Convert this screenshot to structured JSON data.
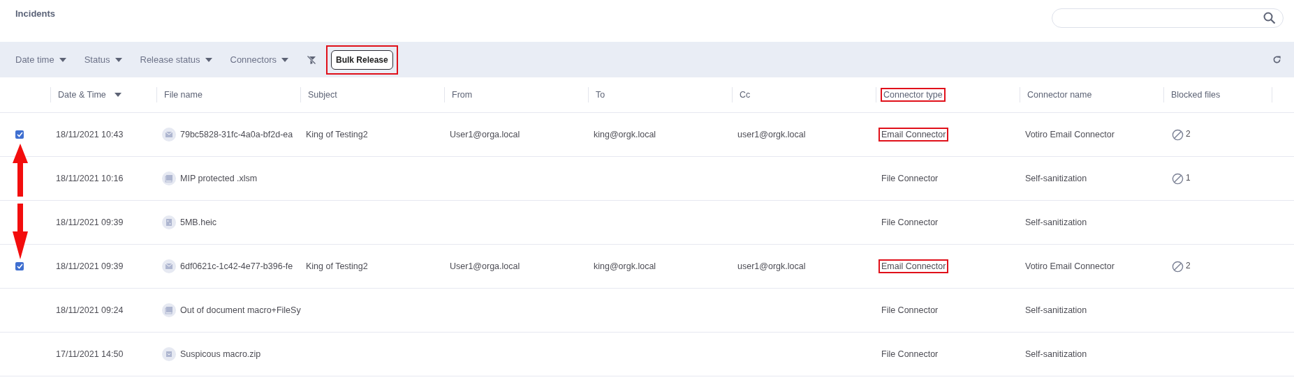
{
  "page": {
    "title": "Incidents"
  },
  "toolbar": {
    "filters": [
      {
        "label": "Date time"
      },
      {
        "label": "Status"
      },
      {
        "label": "Release status"
      },
      {
        "label": "Connectors"
      }
    ],
    "bulk_release": {
      "label": "Bulk Release",
      "highlighted": true
    }
  },
  "table": {
    "columns": [
      {
        "label": "Date & Time",
        "sorted": true,
        "highlighted": false
      },
      {
        "label": "File name",
        "sorted": false,
        "highlighted": false
      },
      {
        "label": "Subject",
        "sorted": false,
        "highlighted": false
      },
      {
        "label": "From",
        "sorted": false,
        "highlighted": false
      },
      {
        "label": "To",
        "sorted": false,
        "highlighted": false
      },
      {
        "label": "Cc",
        "sorted": false,
        "highlighted": false
      },
      {
        "label": "Connector type",
        "sorted": false,
        "highlighted": true
      },
      {
        "label": "Connector name",
        "sorted": false,
        "highlighted": false
      },
      {
        "label": "Blocked files",
        "sorted": false,
        "highlighted": false
      }
    ],
    "rows": [
      {
        "checked": true,
        "date": "18/11/2021 10:43",
        "file": {
          "name": "79bc5828-31fc-4a0a-bf2d-ea",
          "kind": "email"
        },
        "subject": "King of Testing2",
        "from": "User1@orga.local",
        "to": "king@orgk.local",
        "cc": "user1@orgk.local",
        "connector_type": {
          "text": "Email Connector",
          "highlighted": true
        },
        "connector_name": "Votiro Email Connector",
        "blocked_files": "2"
      },
      {
        "checked": false,
        "date": "18/11/2021 10:16",
        "file": {
          "name": "MIP protected .xlsm",
          "kind": "spreadsheet"
        },
        "connector_type": {
          "text": "File Connector",
          "highlighted": false
        },
        "connector_name": "Self-sanitization",
        "blocked_files": "1"
      },
      {
        "checked": false,
        "date": "18/11/2021 09:39",
        "file": {
          "name": "5MB.heic",
          "kind": "binary"
        },
        "connector_type": {
          "text": "File Connector",
          "highlighted": false
        },
        "connector_name": "Self-sanitization"
      },
      {
        "checked": true,
        "date": "18/11/2021 09:39",
        "file": {
          "name": "6df0621c-1c42-4e77-b396-fe",
          "kind": "email"
        },
        "subject": "King of Testing2",
        "from": "User1@orga.local",
        "to": "king@orgk.local",
        "cc": "user1@orgk.local",
        "connector_type": {
          "text": "Email Connector",
          "highlighted": true
        },
        "connector_name": "Votiro Email Connector",
        "blocked_files": "2"
      },
      {
        "checked": false,
        "date": "18/11/2021 09:24",
        "file": {
          "name": "Out of document macro+FileSy",
          "kind": "document"
        },
        "connector_type": {
          "text": "File Connector",
          "highlighted": false
        },
        "connector_name": "Self-sanitization"
      },
      {
        "checked": false,
        "date": "17/11/2021 14:50",
        "file": {
          "name": "Suspicous macro.zip",
          "kind": "archive"
        },
        "connector_type": {
          "text": "File Connector",
          "highlighted": false
        },
        "connector_name": "Self-sanitization"
      }
    ]
  }
}
